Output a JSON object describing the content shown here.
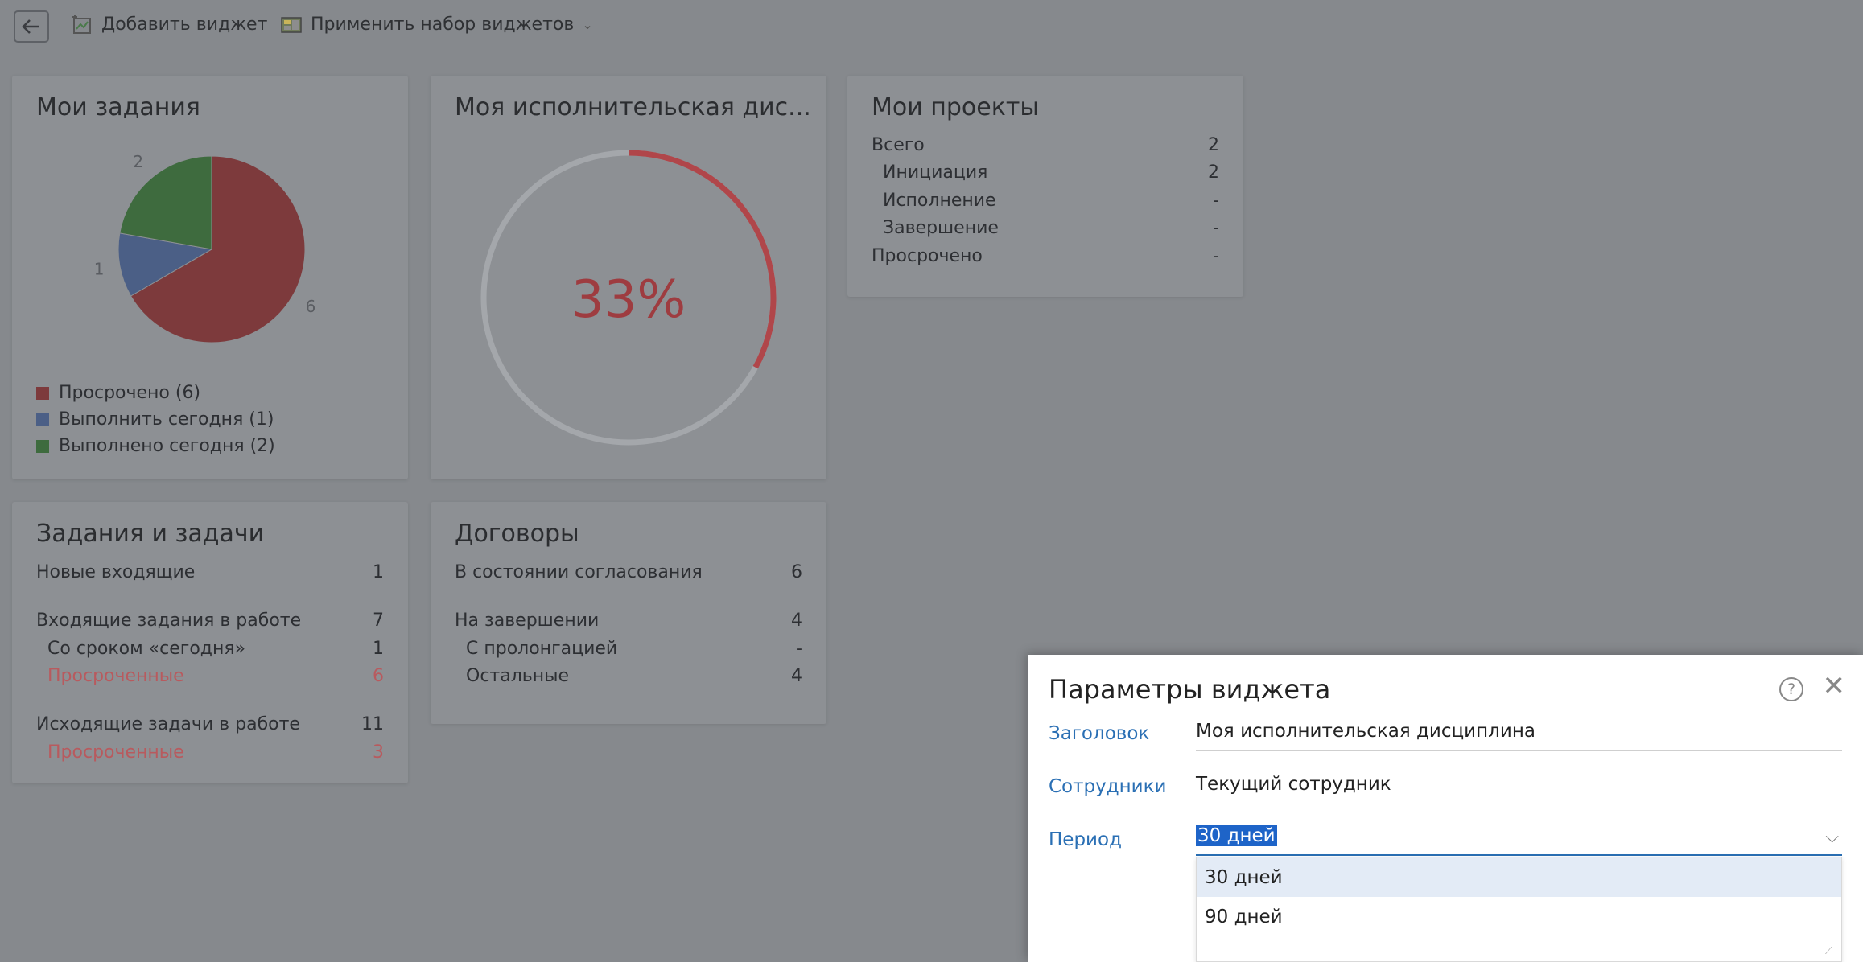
{
  "toolbar": {
    "add_widget": "Добавить виджет",
    "apply_set": "Применить набор виджетов"
  },
  "my_tasks": {
    "title": "Мои задания",
    "legend": [
      {
        "label": "Просрочено (6)",
        "color": "#7d3a3c"
      },
      {
        "label": "Выполнить сегодня (1)",
        "color": "#4b5f86"
      },
      {
        "label": "Выполнено сегодня (2)",
        "color": "#3e6b3e"
      }
    ],
    "pie_labels": {
      "overdue": "6",
      "today": "1",
      "done": "2"
    }
  },
  "chart_data": {
    "type": "pie",
    "categories": [
      "Просрочено",
      "Выполнить сегодня",
      "Выполнено сегодня"
    ],
    "values": [
      6,
      1,
      2
    ],
    "colors": [
      "#7d3a3c",
      "#4b5f86",
      "#3e6b3e"
    ]
  },
  "discipline": {
    "title": "Моя исполнительская дис...",
    "percent_text": "33%",
    "percent_value": 33,
    "arc_color": "#b0464a",
    "track_color": "#a4a7ab"
  },
  "projects": {
    "title": "Мои проекты",
    "rows": [
      {
        "label": "Всего",
        "value": "2",
        "indent": false
      },
      {
        "label": "Инициация",
        "value": "2",
        "indent": true
      },
      {
        "label": "Исполнение",
        "value": "-",
        "indent": true
      },
      {
        "label": "Завершение",
        "value": "-",
        "indent": true
      },
      {
        "label": "Просрочено",
        "value": "-",
        "indent": false
      }
    ]
  },
  "tasks_jobs": {
    "title": "Задания и задачи",
    "rows": [
      {
        "label": "Новые входящие",
        "value": "1"
      },
      {
        "label": "Входящие задания в работе",
        "value": "7"
      },
      {
        "label": "Со сроком «сегодня»",
        "value": "1"
      },
      {
        "label": "Просроченные",
        "value": "6"
      },
      {
        "label": "Исходящие задачи в работе",
        "value": "11"
      },
      {
        "label": "Просроченные",
        "value": "3"
      }
    ]
  },
  "contracts": {
    "title": "Договоры",
    "rows": [
      {
        "label": "В состоянии согласования",
        "value": "6"
      },
      {
        "label": "На завершении",
        "value": "4"
      },
      {
        "label": "С пролонгацией",
        "value": "-"
      },
      {
        "label": "Остальные",
        "value": "4"
      }
    ]
  },
  "dialog": {
    "title": "Параметры виджета",
    "help_symbol": "?",
    "fields": {
      "title_label": "Заголовок",
      "title_value": "Моя исполнительская дисциплина",
      "employees_label": "Сотрудники",
      "employees_value": "Текущий сотрудник",
      "period_label": "Период",
      "period_value": "30 дней"
    },
    "options": [
      "30 дней",
      "90 дней"
    ]
  }
}
